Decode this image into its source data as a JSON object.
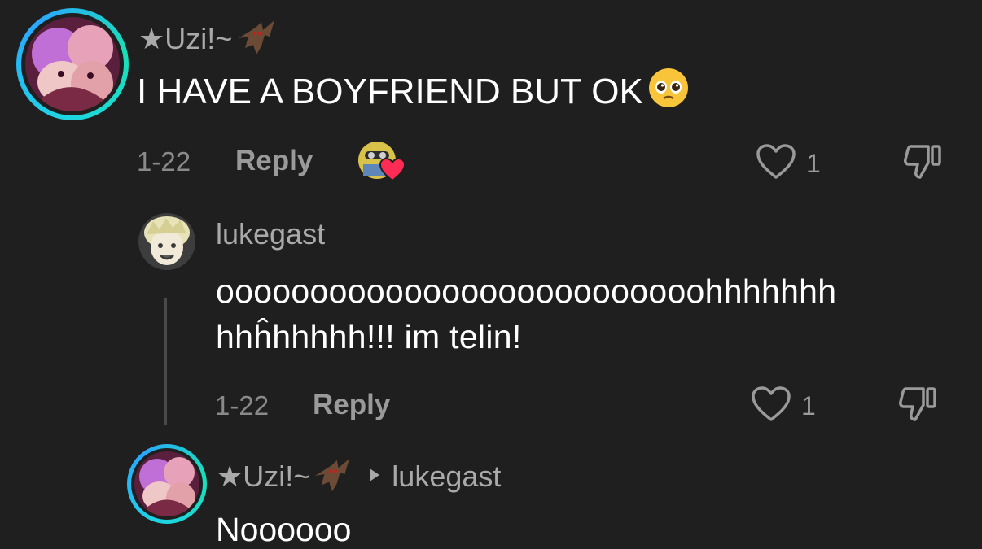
{
  "comments": [
    {
      "username": "★Uzi!~",
      "text": "I HAVE A BOYFRIEND BUT OK",
      "date": "1-22",
      "reply_label": "Reply",
      "likes": "1",
      "icons": [
        "bat-emoji-icon",
        "pleading-face-emoji-icon",
        "creator-liked-heart-icon",
        "heart-icon",
        "dislike-icon"
      ]
    },
    {
      "username": "lukegast",
      "text_line1": "oooooooooooooooooooooooooohhhhhhh",
      "text_line2": "hhĥhhhhh!!! im telin!",
      "date": "1-22",
      "reply_label": "Reply",
      "likes": "1"
    },
    {
      "username": "★Uzi!~",
      "reply_to": "lukegast",
      "text": "Noooooo"
    }
  ],
  "colors": {
    "background": "#1f1f1f",
    "username": "#a9a9a9",
    "meta": "#8a8a8a",
    "ring": "#1fd3e6",
    "like_heart_badge": "#fe2c55"
  }
}
